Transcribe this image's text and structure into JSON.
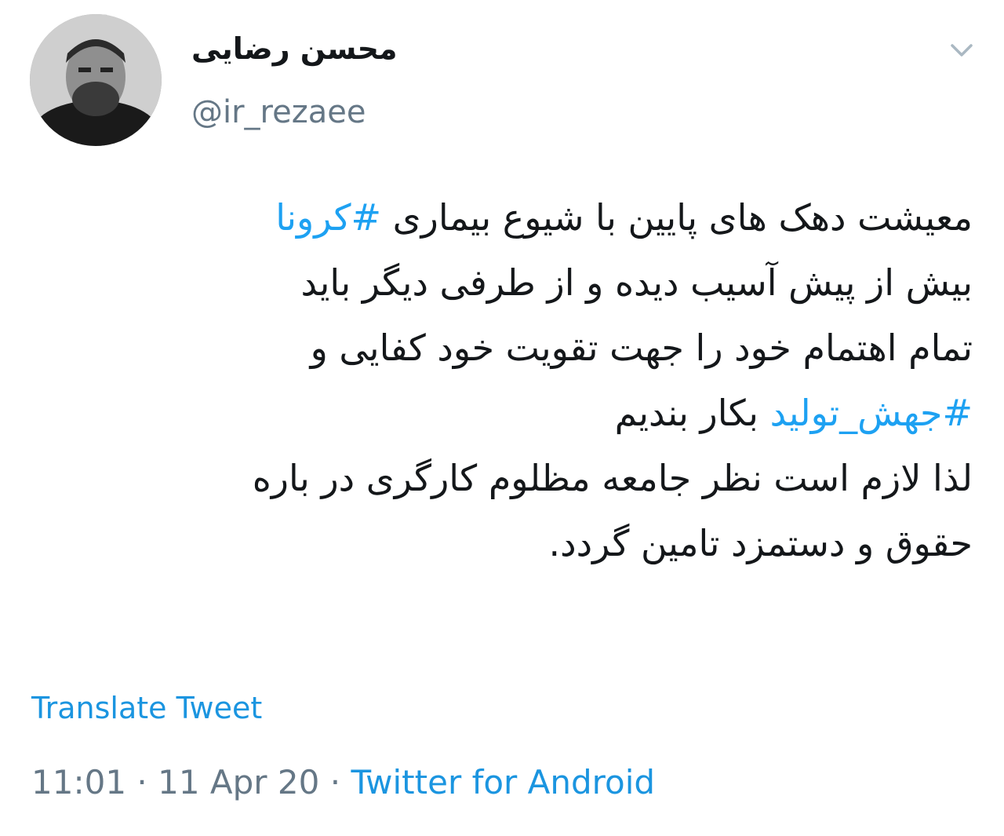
{
  "author": {
    "display_name": "محسن رضایی",
    "handle": "@ir_rezaee"
  },
  "tweet": {
    "lines": [
      {
        "text": "معیشت دهک های پایین با شیوع بیماری ",
        "hashtag": "#کرونا"
      },
      {
        "text": "بیش از پیش آسیب دیده و از طرفی دیگر باید"
      },
      {
        "text": "تمام اهتمام خود را جهت تقویت خود کفایی و"
      },
      {
        "hashtag": "#جهش_تولید",
        "text": " بکار بندیم"
      },
      {
        "text": "لذا لازم است نظر جامعه مظلوم کارگری در باره"
      },
      {
        "text": "حقوق و دستمزد تامین گردد."
      }
    ],
    "translate_label": "Translate Tweet",
    "time": "11:01",
    "separator": "·",
    "date": "11 Apr 20",
    "source": "Twitter for Android"
  },
  "icons": {
    "menu": "chevron-down-icon",
    "avatar": "profile-photo"
  },
  "colors": {
    "hashtag": "#1da1f2",
    "link": "#1b95e0",
    "muted": "#657786",
    "text": "#14171a"
  }
}
